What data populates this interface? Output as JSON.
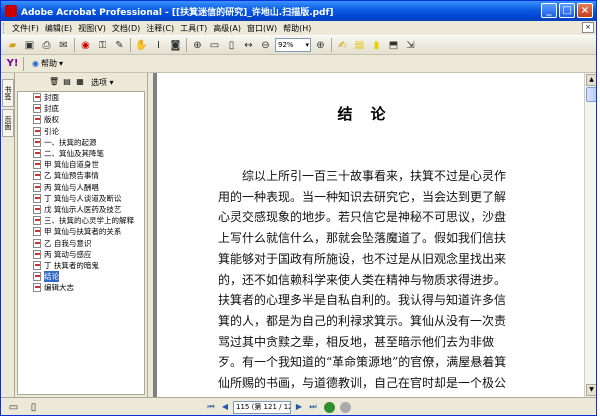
{
  "window": {
    "title": "Adobe Acrobat Professional - [[扶箕迷信的研究]_许地山.扫描版.pdf]",
    "controls": [
      "_",
      "□",
      "×"
    ]
  },
  "menu": [
    {
      "label": "文件(F)"
    },
    {
      "label": "编辑(E)"
    },
    {
      "label": "视图(V)"
    },
    {
      "label": "文档(D)"
    },
    {
      "label": "注释(C)"
    },
    {
      "label": "工具(T)"
    },
    {
      "label": "高级(A)"
    },
    {
      "label": "窗口(W)"
    },
    {
      "label": "帮助(H)"
    }
  ],
  "toolbar": {
    "zoom_value": "92%",
    "help_label": "帮助"
  },
  "nav_pane": {
    "tabs": [
      "书签",
      "页面"
    ],
    "options_label": "选项",
    "bookmarks": [
      {
        "label": "封面",
        "selected": false
      },
      {
        "label": "封底",
        "selected": false
      },
      {
        "label": "版权",
        "selected": false
      },
      {
        "label": "引论",
        "selected": false
      },
      {
        "label": "一、扶箕的起源",
        "selected": false
      },
      {
        "label": "二、箕仙及其降笔",
        "selected": false
      },
      {
        "label": "甲 箕仙自道身世",
        "selected": false
      },
      {
        "label": "乙 箕仙预告事情",
        "selected": false
      },
      {
        "label": "丙 箕仙与人酬唱",
        "selected": false
      },
      {
        "label": "丁 箕仙与人谈道及断讼",
        "selected": false
      },
      {
        "label": "戊 箕仙示人医药及技艺",
        "selected": false
      },
      {
        "label": "三、扶箕的心灵学上的解释",
        "selected": false
      },
      {
        "label": "甲 箕仙与扶箕者的关系",
        "selected": false
      },
      {
        "label": "乙 自我与意识",
        "selected": false
      },
      {
        "label": "丙 箕动与感应",
        "selected": false
      },
      {
        "label": "丁 扶箕者的暗鬼",
        "selected": false
      },
      {
        "label": "结论",
        "selected": true
      },
      {
        "label": "编辑大志",
        "selected": false
      }
    ]
  },
  "document": {
    "heading": "结论",
    "lines": [
      "综以上所引一百三十故事看来，扶箕不过是心灵作",
      "用的一种表现。当一种知识去研究它，当会达到更了解",
      "心灵交感现象的地步。若只信它是神秘不可思议，沙盘",
      "上写什么就信什么，那就会坠落魔道了。假如我们信扶",
      "箕能够对于国政有所施设，也不过是从旧观念里找出来",
      "的，还不如信赖科学来使人类在精神与物质求得进步。",
      "扶箕者的心理多半是自私自利的。我认得与知道许多信",
      "箕的人，都是为自己的利禄求箕示。箕仙从没有一次责",
      "骂过其中贪黩之辈，相反地，甚至暗示他们去为非做",
      "歹。有一个我知道的“革命策源地”的官僚，满屋悬着箕",
      "仙所赐的书画，与道德教训，自己在官时却是一个极公"
    ]
  },
  "status": {
    "page_display": "115 (第 121 / 126 页)"
  }
}
